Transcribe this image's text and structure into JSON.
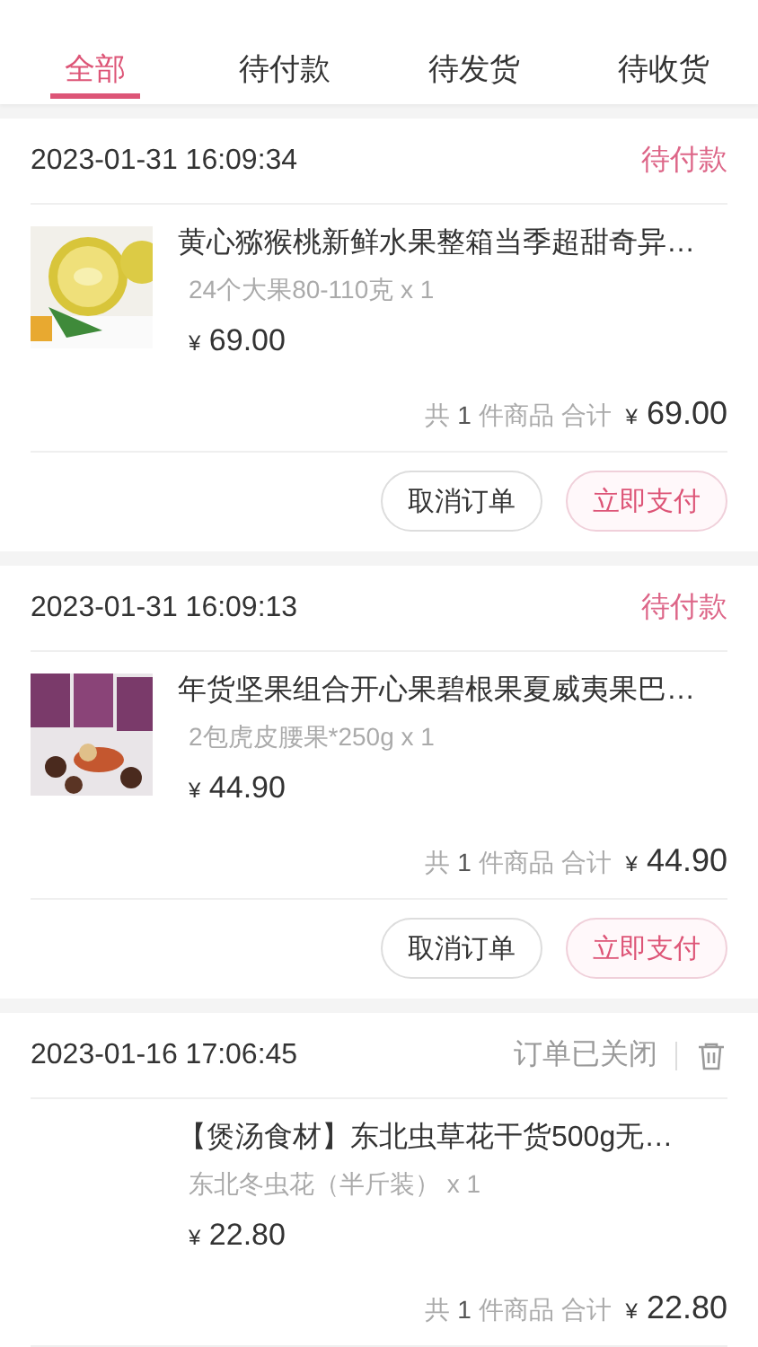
{
  "tabs": [
    {
      "label": "全部",
      "selected": true
    },
    {
      "label": "待付款",
      "selected": false
    },
    {
      "label": "待发货",
      "selected": false
    },
    {
      "label": "待收货",
      "selected": false
    }
  ],
  "orders": [
    {
      "time": "2023-01-31 16:09:34",
      "status": "待付款",
      "closed": false,
      "product": {
        "picture": true,
        "title": "黄心猕猴桃新鲜水果整箱当季超甜奇异…",
        "spec": "24个大果80-110克 x 1",
        "currency": "¥",
        "price": "69.00"
      },
      "summary": {
        "prefix": "共",
        "count": "1",
        "suffix": "件商品 合计",
        "currency": "¥",
        "total": "69.00"
      },
      "buttons": [
        {
          "label": "取消订单",
          "kind": "plain"
        },
        {
          "label": "立即支付",
          "kind": "primary"
        }
      ]
    },
    {
      "time": "2023-01-31 16:09:13",
      "status": "待付款",
      "closed": false,
      "product": {
        "picture": true,
        "title": "年货坚果组合开心果碧根果夏威夷果巴…",
        "spec": "2包虎皮腰果*250g x 1",
        "currency": "¥",
        "price": "44.90"
      },
      "summary": {
        "prefix": "共",
        "count": "1",
        "suffix": "件商品 合计",
        "currency": "¥",
        "total": "44.90"
      },
      "buttons": [
        {
          "label": "取消订单",
          "kind": "plain"
        },
        {
          "label": "立即支付",
          "kind": "primary"
        }
      ]
    },
    {
      "time": "2023-01-16 17:06:45",
      "status": "订单已关闭",
      "closed": true,
      "product": {
        "picture": false,
        "title": "【煲汤食材】东北虫草花干货500g无…",
        "spec": "东北冬虫花（半斤装） x 1",
        "currency": "¥",
        "price": "22.80"
      },
      "summary": {
        "prefix": "共",
        "count": "1",
        "suffix": "件商品 合计",
        "currency": "¥",
        "total": "22.80"
      }
    }
  ]
}
